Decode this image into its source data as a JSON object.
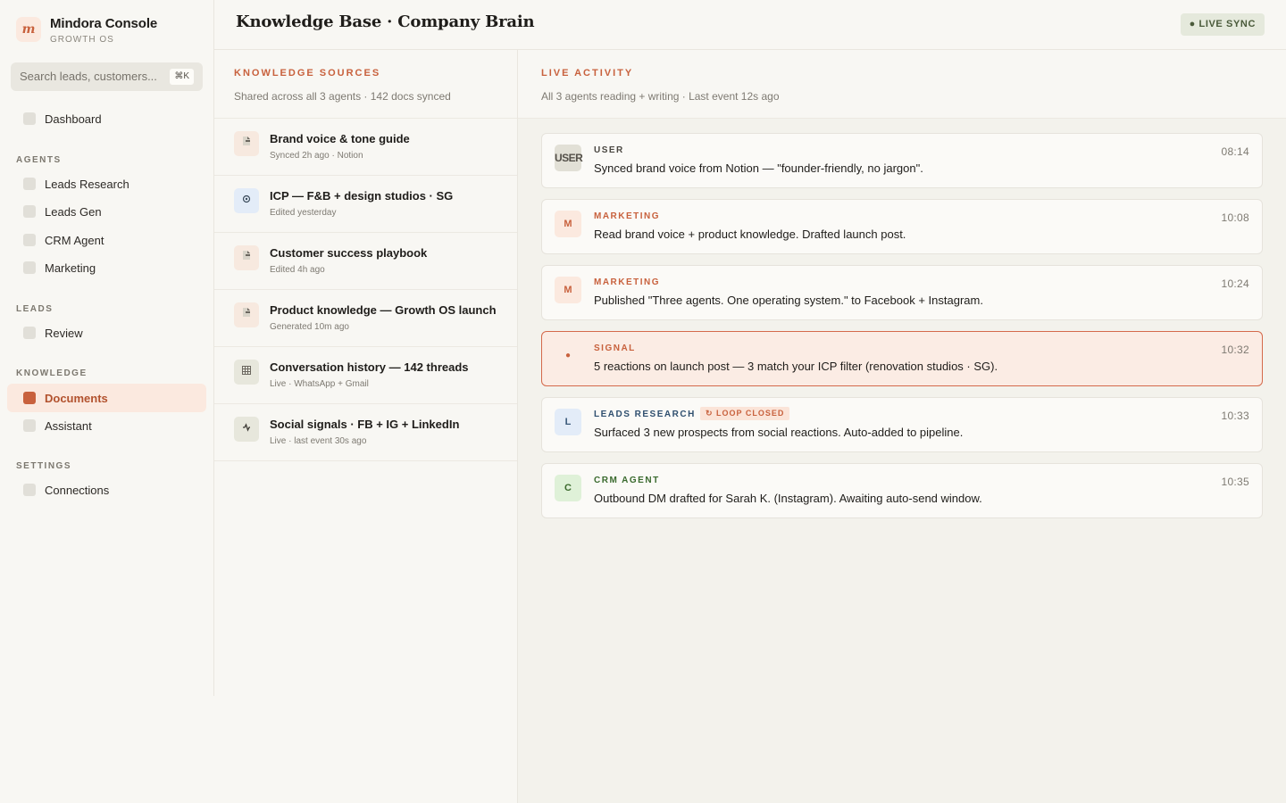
{
  "brand": {
    "name": "Mindora Console",
    "subtitle": "GROWTH OS",
    "logo_letter": "m"
  },
  "search": {
    "placeholder": "Search leads, customers...",
    "shortcut": "⌘K"
  },
  "sidebar": {
    "top_items": [
      {
        "label": "Dashboard",
        "active": false
      }
    ],
    "sections": [
      {
        "title": "AGENTS",
        "items": [
          {
            "label": "Leads Research",
            "active": false
          },
          {
            "label": "Leads Gen",
            "active": false
          },
          {
            "label": "CRM Agent",
            "active": false
          },
          {
            "label": "Marketing",
            "active": false
          }
        ]
      },
      {
        "title": "LEADS",
        "items": [
          {
            "label": "Review",
            "active": false
          }
        ]
      },
      {
        "title": "KNOWLEDGE",
        "items": [
          {
            "label": "Documents",
            "active": true
          },
          {
            "label": "Assistant",
            "active": false
          }
        ]
      },
      {
        "title": "SETTINGS",
        "items": [
          {
            "label": "Connections",
            "active": false
          }
        ]
      }
    ]
  },
  "header": {
    "title": "Knowledge Base · Company Brain",
    "live_sync": "● LIVE SYNC"
  },
  "sources": {
    "title": "KNOWLEDGE SOURCES",
    "subtitle": "Shared across all 3 agents · 142 docs synced",
    "items": [
      {
        "icon": "document-icon",
        "title": "Brand voice & tone guide",
        "meta": "Synced 2h ago · Notion"
      },
      {
        "icon": "target-icon",
        "title": "ICP — F&B + design studios · SG",
        "meta": "Edited yesterday"
      },
      {
        "icon": "document-icon",
        "title": "Customer success playbook",
        "meta": "Edited 4h ago"
      },
      {
        "icon": "document-icon",
        "title": "Product knowledge — Growth OS launch",
        "meta": "Generated 10m ago"
      },
      {
        "icon": "grid-icon",
        "title": "Conversation history — 142 threads",
        "meta": "Live · WhatsApp + Gmail"
      },
      {
        "icon": "pulse-icon",
        "title": "Social signals · FB + IG + LinkedIn",
        "meta": "Live · last event 30s ago"
      }
    ]
  },
  "activity": {
    "title": "LIVE ACTIVITY",
    "subtitle": "All 3 agents reading + writing · Last event 12s ago",
    "events": [
      {
        "badge": "USER",
        "agent": "USER",
        "text": "Synced brand voice from Notion — \"founder-friendly, no jargon\".",
        "time": "08:14"
      },
      {
        "badge": "M",
        "agent": "MARKETING",
        "text": "Read brand voice + product knowledge. Drafted launch post.",
        "time": "10:08"
      },
      {
        "badge": "M",
        "agent": "MARKETING",
        "text": "Published \"Three agents. One operating system.\" to Facebook + Instagram.",
        "time": "10:24"
      },
      {
        "badge": "●",
        "agent": "SIGNAL",
        "text": "5 reactions on launch post — 3 match your ICP filter (renovation studios · SG).",
        "time": "10:32"
      },
      {
        "badge": "L",
        "agent": "LEADS RESEARCH",
        "tag": "↻ LOOP CLOSED",
        "text": "Surfaced 3 new prospects from social reactions. Auto-added to pipeline.",
        "time": "10:33"
      },
      {
        "badge": "C",
        "agent": "CRM AGENT",
        "text": "Outbound DM drafted for Sarah K. (Instagram). Awaiting auto-send window.",
        "time": "10:35"
      }
    ]
  },
  "colors": {
    "accent": "#c8613d",
    "background": "#f8f7f3",
    "signal_bg": "#fbece4"
  }
}
